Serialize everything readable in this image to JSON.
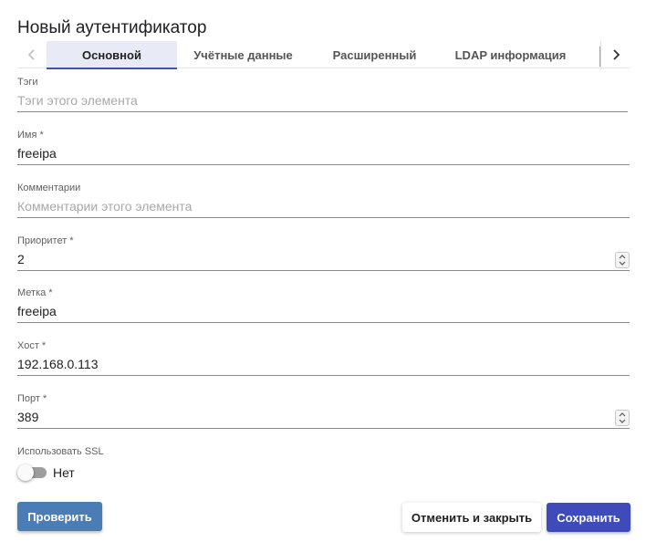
{
  "dialog": {
    "title": "Новый аутентификатор"
  },
  "tabs": [
    {
      "label": "Основной",
      "active": true
    },
    {
      "label": "Учётные данные",
      "active": false
    },
    {
      "label": "Расширенный",
      "active": false
    },
    {
      "label": "LDAP информация",
      "active": false
    }
  ],
  "icons": {
    "tab_prev": "chevron-left-icon",
    "tab_next": "chevron-right-icon",
    "spinner": "updown-arrows-icon"
  },
  "form": {
    "tags": {
      "label": "Тэги",
      "value": "",
      "placeholder": "Тэги этого элемента"
    },
    "name": {
      "label": "Имя *",
      "value": "freeipa",
      "placeholder": ""
    },
    "comments": {
      "label": "Комментарии",
      "value": "",
      "placeholder": "Комментарии этого элемента"
    },
    "priority": {
      "label": "Приоритет *",
      "value": "2"
    },
    "tag": {
      "label": "Метка *",
      "value": "freeipa"
    },
    "host": {
      "label": "Хост *",
      "value": "192.168.0.113"
    },
    "port": {
      "label": "Порт *",
      "value": "389"
    },
    "ssl": {
      "label": "Использовать SSL",
      "state_text": "Нет",
      "enabled": false
    }
  },
  "buttons": {
    "test": "Проверить",
    "cancel": "Отменить и закрыть",
    "save": "Сохранить"
  },
  "colors": {
    "primary": "#3f4bb8",
    "test_button": "#4a7db5",
    "active_tab_bg": "#e8ebf6"
  }
}
